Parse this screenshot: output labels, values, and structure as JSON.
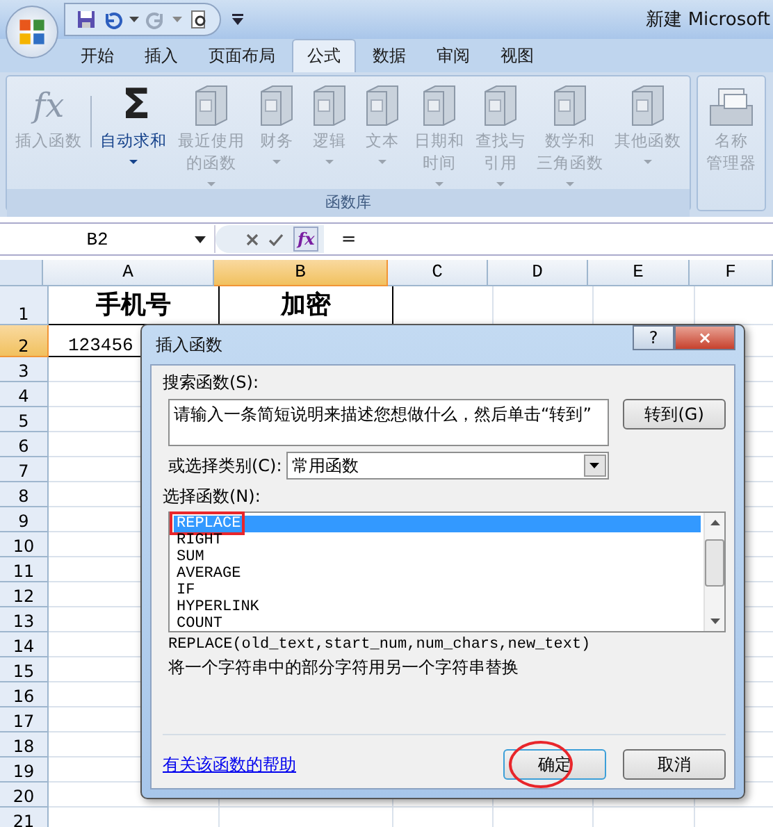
{
  "window": {
    "title": "新建 Microsoft"
  },
  "tabs": [
    {
      "label": "开始",
      "selected": false
    },
    {
      "label": "插入",
      "selected": false
    },
    {
      "label": "页面布局",
      "selected": false
    },
    {
      "label": "公式",
      "selected": true
    },
    {
      "label": "数据",
      "selected": false
    },
    {
      "label": "审阅",
      "selected": false
    },
    {
      "label": "视图",
      "selected": false
    }
  ],
  "ribbon": {
    "groups": [
      {
        "label": "函数库",
        "items": [
          {
            "kind": "glyph",
            "glyph": "fx",
            "lines": [
              "插入函数"
            ],
            "disabled": true,
            "dropdown": false
          },
          {
            "kind": "glyph",
            "glyph": "Σ",
            "lines": [
              "自动求和"
            ],
            "disabled": false,
            "dropdown": true
          },
          {
            "kind": "book",
            "lines": [
              "最近使用",
              "的函数"
            ],
            "disabled": true,
            "dropdown": true
          },
          {
            "kind": "book",
            "lines": [
              "财务"
            ],
            "disabled": true,
            "dropdown": true
          },
          {
            "kind": "book",
            "lines": [
              "逻辑"
            ],
            "disabled": true,
            "dropdown": true
          },
          {
            "kind": "book",
            "lines": [
              "文本"
            ],
            "disabled": true,
            "dropdown": true
          },
          {
            "kind": "book",
            "lines": [
              "日期和",
              "时间"
            ],
            "disabled": true,
            "dropdown": true
          },
          {
            "kind": "book",
            "lines": [
              "查找与",
              "引用"
            ],
            "disabled": true,
            "dropdown": true
          },
          {
            "kind": "book",
            "lines": [
              "数学和",
              "三角函数"
            ],
            "disabled": true,
            "dropdown": true
          },
          {
            "kind": "book",
            "lines": [
              "其他函数"
            ],
            "disabled": true,
            "dropdown": true
          }
        ]
      },
      {
        "items": [
          {
            "kind": "cards",
            "lines": [
              "名称",
              "管理器"
            ],
            "disabled": true,
            "dropdown": false
          }
        ]
      }
    ]
  },
  "formula_bar": {
    "name_box": "B2",
    "glyph": "fx",
    "formula": "="
  },
  "sheet": {
    "columns": [
      {
        "label": "A",
        "selected": false
      },
      {
        "label": "B",
        "selected": true
      },
      {
        "label": "C",
        "selected": false
      },
      {
        "label": "D",
        "selected": false
      },
      {
        "label": "E",
        "selected": false
      },
      {
        "label": "F",
        "selected": false
      }
    ],
    "rows": [
      {
        "label": "1",
        "selected": false,
        "cells": [
          "手机号",
          "加密"
        ]
      },
      {
        "label": "2",
        "selected": true,
        "cells": [
          "123456"
        ]
      },
      {
        "label": "3",
        "selected": false
      },
      {
        "label": "4",
        "selected": false
      },
      {
        "label": "5",
        "selected": false
      },
      {
        "label": "6",
        "selected": false
      },
      {
        "label": "7",
        "selected": false
      },
      {
        "label": "8",
        "selected": false
      },
      {
        "label": "9",
        "selected": false
      },
      {
        "label": "10",
        "selected": false
      },
      {
        "label": "11",
        "selected": false
      },
      {
        "label": "12",
        "selected": false
      },
      {
        "label": "13",
        "selected": false
      },
      {
        "label": "14",
        "selected": false
      },
      {
        "label": "15",
        "selected": false
      },
      {
        "label": "16",
        "selected": false
      },
      {
        "label": "17",
        "selected": false
      },
      {
        "label": "18",
        "selected": false
      },
      {
        "label": "19",
        "selected": false
      },
      {
        "label": "20",
        "selected": false
      },
      {
        "label": "21",
        "selected": false
      }
    ]
  },
  "dialog": {
    "title": "插入函数",
    "help": "?",
    "close": "×",
    "search_label": "搜索函数(S):",
    "search_value": "请输入一条简短说明来描述您想做什么，然后单击“转到”",
    "go_button": "转到(G)",
    "category_label": "或选择类别(C):",
    "category_value": "常用函数",
    "list_label": "选择函数(N):",
    "functions": [
      {
        "name": "REPLACE",
        "selected": true,
        "highlighted": true
      },
      {
        "name": "RIGHT",
        "selected": false,
        "highlighted": false
      },
      {
        "name": "SUM",
        "selected": false,
        "highlighted": false
      },
      {
        "name": "AVERAGE",
        "selected": false,
        "highlighted": false
      },
      {
        "name": "IF",
        "selected": false,
        "highlighted": false
      },
      {
        "name": "HYPERLINK",
        "selected": false,
        "highlighted": false
      },
      {
        "name": "COUNT",
        "selected": false,
        "highlighted": false
      }
    ],
    "signature": "REPLACE(old_text,start_num,num_chars,new_text)",
    "description": "将一个字符串中的部分字符用另一个字符串替换",
    "help_link": "有关该函数的帮助",
    "buttons": [
      {
        "label": "确定",
        "default": true,
        "circled": true
      },
      {
        "label": "取消",
        "default": false,
        "circled": false
      }
    ]
  }
}
